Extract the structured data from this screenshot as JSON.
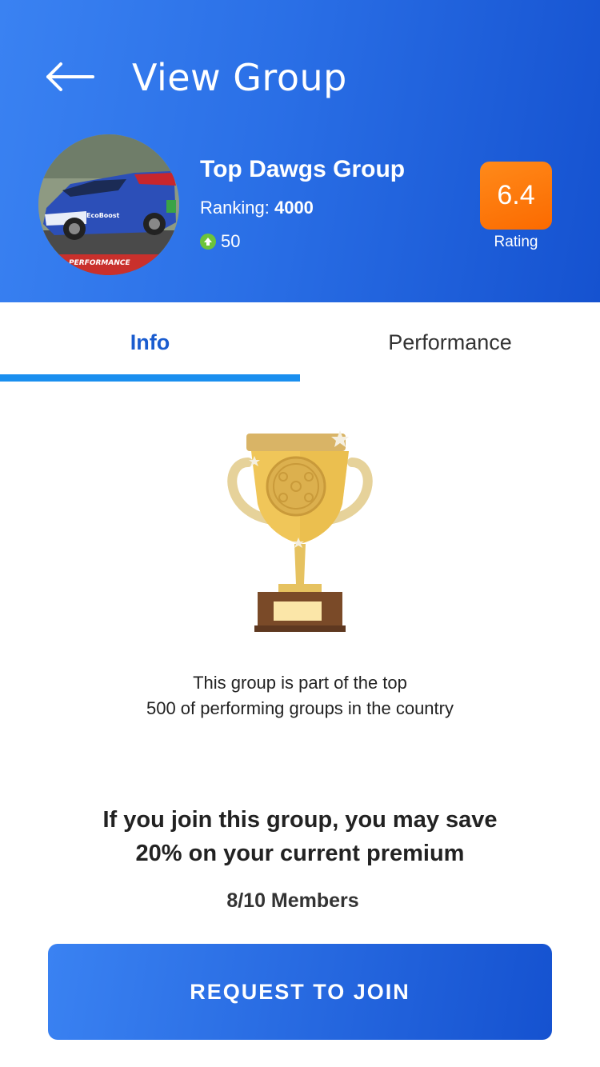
{
  "header": {
    "title": "View Group",
    "back_icon": "arrow-left-icon"
  },
  "group": {
    "name": "Top Dawgs Group",
    "ranking_label": "Ranking:",
    "ranking_value": "4000",
    "points": "50",
    "points_icon": "arrow-up-circle-icon",
    "avatar_text": "PERFORMANCE"
  },
  "rating": {
    "value": "6.4",
    "label": "Rating"
  },
  "tabs": [
    {
      "label": "Info",
      "active": true
    },
    {
      "label": "Performance",
      "active": false
    }
  ],
  "info": {
    "top_line1": "This group is part of the top",
    "top_line2": "500 of performing groups in the country",
    "save_line1": "If you join this group, you may save",
    "save_line2": "20% on your current premium",
    "members": "8/10 Members"
  },
  "cta": {
    "label": "REQUEST TO JOIN"
  },
  "colors": {
    "header_start": "#3a82f2",
    "header_end": "#1552d0",
    "rating_orange": "#fb6a00",
    "tab_active": "#1a5ccf",
    "tab_underline": "#1a8fef",
    "points_green": "#6cc43b"
  }
}
